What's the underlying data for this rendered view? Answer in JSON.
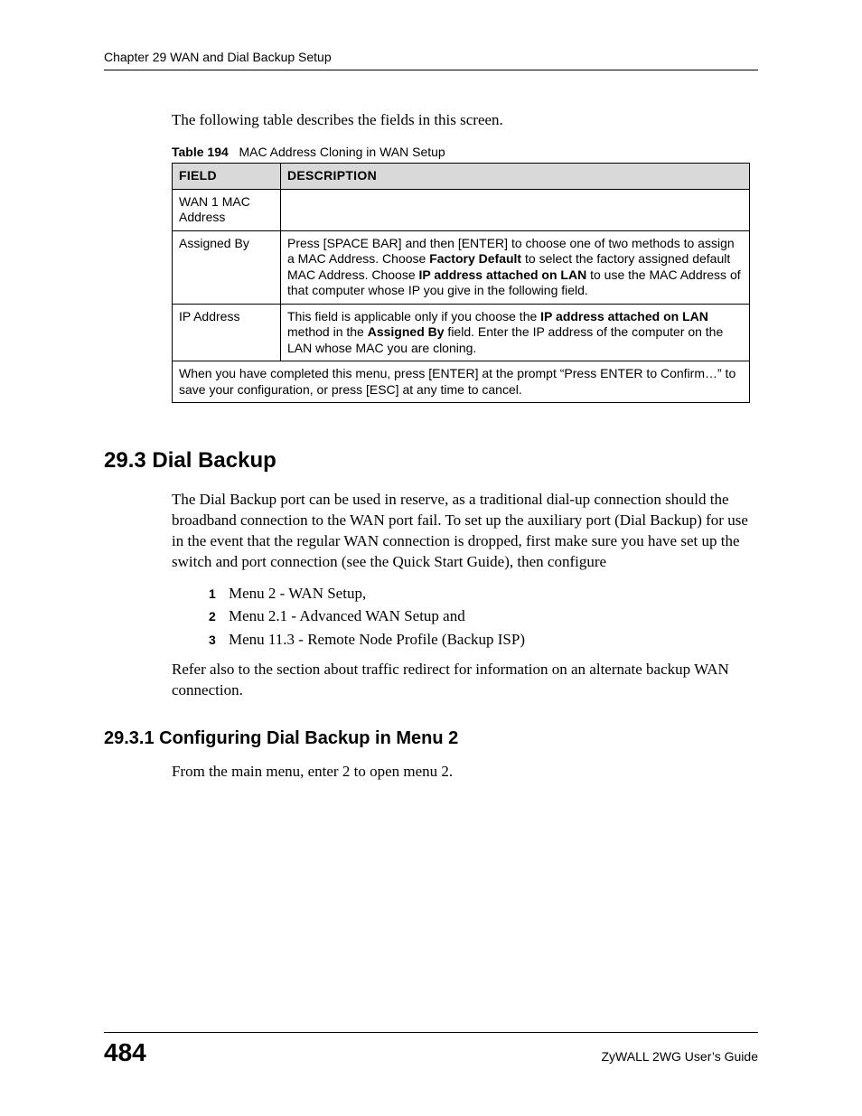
{
  "header": {
    "running": "Chapter 29 WAN and Dial Backup Setup"
  },
  "intro": "The following table describes the fields in this screen.",
  "table": {
    "label": "Table 194",
    "caption": "MAC Address Cloning in WAN Setup",
    "head": {
      "field": "FIELD",
      "desc": "DESCRIPTION"
    },
    "rows": {
      "r1_field": "WAN 1 MAC Address",
      "r1_desc": "",
      "r2_field": "Assigned By",
      "r2_desc_a": "Press [SPACE BAR] and then [ENTER] to choose one of two methods to assign a MAC Address. Choose ",
      "r2_desc_b": "Factory Default",
      "r2_desc_c": " to select the factory assigned default MAC Address. Choose ",
      "r2_desc_d": "IP address attached on LAN",
      "r2_desc_e": " to use the MAC Address of that computer whose IP you give in the following field.",
      "r3_field": "IP Address",
      "r3_desc_a": "This field is applicable only if you choose the ",
      "r3_desc_b": "IP address attached on LAN",
      "r3_desc_c": " method in the ",
      "r3_desc_d": "Assigned By",
      "r3_desc_e": " field. Enter the IP address of the computer on the LAN whose MAC you are cloning.",
      "r4": "When you have completed this menu, press [ENTER] at the prompt “Press ENTER to Confirm…” to save your configuration, or press [ESC] at any time to cancel."
    }
  },
  "section": {
    "h2": "29.3  Dial Backup",
    "p1": "The Dial Backup port can be used in reserve, as a traditional dial-up connection should the broadband connection to the WAN port fail. To set up the auxiliary port (Dial Backup) for use in the event that the regular WAN connection is dropped, first make sure you have set up the switch and port connection (see the Quick Start Guide), then configure",
    "list": {
      "i1": "Menu 2 - WAN Setup,",
      "i2": "Menu 2.1 - Advanced WAN Setup and",
      "i3": "Menu 11.3 - Remote Node Profile (Backup ISP)"
    },
    "p2": "Refer also to the section about traffic redirect for information on an alternate backup WAN connection.",
    "h3": "29.3.1  Configuring Dial Backup in Menu 2",
    "p3": "From the main menu, enter 2 to open menu 2."
  },
  "footer": {
    "page": "484",
    "guide": "ZyWALL 2WG User’s Guide"
  }
}
